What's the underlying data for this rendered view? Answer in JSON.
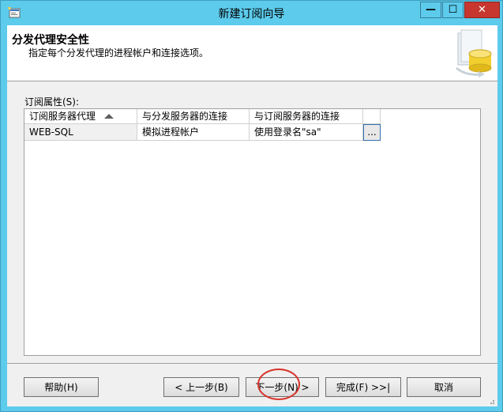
{
  "window": {
    "title": "新建订阅向导",
    "buttons": {
      "minimize": "—",
      "maximize": "☐",
      "close": "✕"
    }
  },
  "header": {
    "title": "分发代理安全性",
    "subtitle": "指定每个分发代理的进程帐户和连接选项。",
    "graphic_icon": "database-wizard-icon"
  },
  "properties": {
    "label": "订阅属性(S):",
    "columns": [
      "订阅服务器代理",
      "与分发服务器的连接",
      "与订阅服务器的连接"
    ],
    "sort_column": 0,
    "rows": [
      {
        "agent": "WEB-SQL",
        "distributor_conn": "模拟进程帐户",
        "subscriber_conn": "使用登录名\"sa\""
      }
    ],
    "ellipsis_label": "..."
  },
  "footer": {
    "help": "帮助(H)",
    "back": "< 上一步(B)",
    "next": "下一步(N) >",
    "finish": "完成(F) >>|",
    "cancel": "取消"
  },
  "colors": {
    "titlebar": "#5ccbec",
    "close_button": "#c7372f",
    "highlight": "#d8322a"
  }
}
